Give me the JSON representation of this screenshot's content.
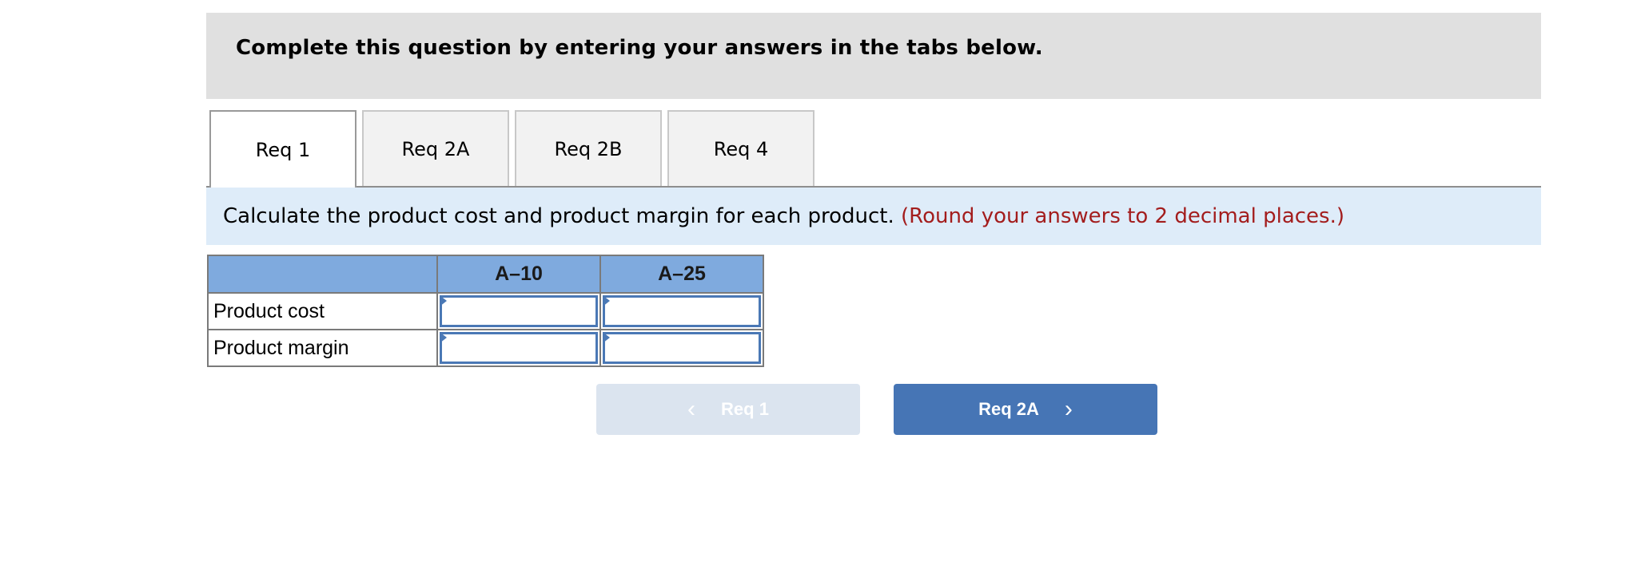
{
  "header": {
    "instruction": "Complete this question by entering your answers in the tabs below."
  },
  "tabs": [
    {
      "label": "Req 1",
      "active": true
    },
    {
      "label": "Req 2A",
      "active": false
    },
    {
      "label": "Req 2B",
      "active": false
    },
    {
      "label": "Req 4",
      "active": false
    }
  ],
  "question": {
    "text": "Calculate the product cost and product margin for each product.",
    "note": "(Round your answers to 2 decimal places.)"
  },
  "table": {
    "columns": [
      "",
      "A–10",
      "A–25"
    ],
    "rows": [
      {
        "label": "Product cost",
        "values": [
          "",
          ""
        ]
      },
      {
        "label": "Product margin",
        "values": [
          "",
          ""
        ]
      }
    ]
  },
  "navigation": {
    "prev_label": "Req 1",
    "next_label": "Req 2A",
    "prev_icon": "chevron-left-icon",
    "next_icon": "chevron-right-icon"
  },
  "colors": {
    "header_bg": "#e0e0e0",
    "instruction_bg": "#deecf9",
    "note_color": "#a31d1d",
    "table_header_bg": "#7faade",
    "primary_button": "#4675b5",
    "disabled_button": "#dbe4ef"
  }
}
